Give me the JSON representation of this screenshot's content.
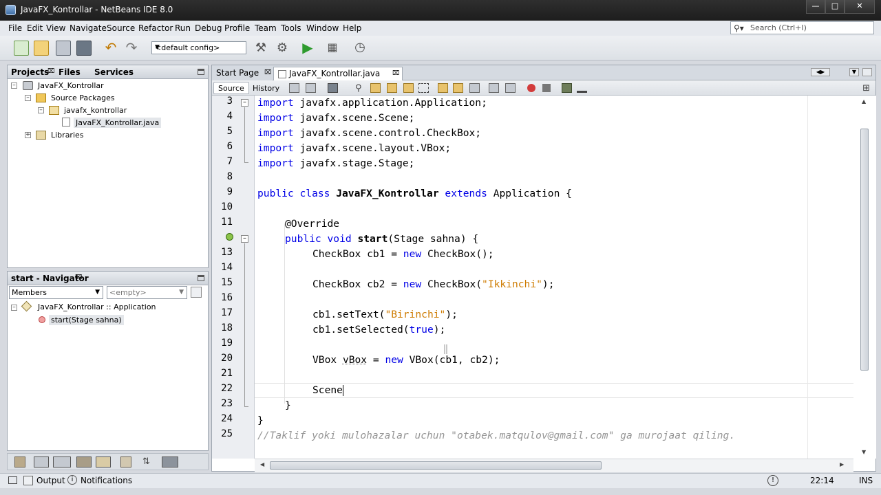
{
  "window": {
    "title": "JavaFX_Kontrollar - NetBeans IDE 8.0"
  },
  "menu": [
    "File",
    "Edit",
    "View",
    "Navigate",
    "Source",
    "Refactor",
    "Run",
    "Debug",
    "Profile",
    "Team",
    "Tools",
    "Window",
    "Help"
  ],
  "search": {
    "placeholder": "Search (Ctrl+I)"
  },
  "toolbar": {
    "config_value": "<default config>"
  },
  "projects_panel": {
    "tabs": [
      "Projects",
      "Files",
      "Services"
    ],
    "tree": [
      "JavaFX_Kontrollar",
      "Source Packages",
      "javafx_kontrollar",
      "JavaFX_Kontrollar.java",
      "Libraries"
    ]
  },
  "navigator": {
    "title": "start - Navigator",
    "members_value": "Members",
    "filter_value": "<empty>",
    "tree": [
      "JavaFX_Kontrollar :: Application",
      "start(Stage sahna)"
    ]
  },
  "editor": {
    "tabs": [
      "Start Page",
      "JavaFX_Kontrollar.java"
    ],
    "source_label": "Source",
    "history_label": "History",
    "line_numbers": [
      "3",
      "4",
      "5",
      "6",
      "7",
      "8",
      "9",
      "10",
      "11",
      "",
      "13",
      "14",
      "15",
      "16",
      "17",
      "18",
      "19",
      "20",
      "21",
      "22",
      "23",
      "24",
      "25"
    ],
    "code": {
      "l3a": "import",
      "l3b": " javafx.application.Application;",
      "l4a": "import",
      "l4b": " javafx.scene.Scene;",
      "l5a": "import",
      "l5b": " javafx.scene.control.CheckBox;",
      "l6a": "import",
      "l6b": " javafx.scene.layout.VBox;",
      "l7a": "import",
      "l7b": " javafx.stage.Stage;",
      "l9a": "public class",
      "l9b": "JavaFX_Kontrollar",
      "l9c": "extends",
      "l9d": " Application {",
      "l11": "@Override",
      "l12a": "public void",
      "l12b": "start",
      "l12c": "(Stage sahna) {",
      "l13a": "CheckBox cb1 = ",
      "l13b": "new",
      "l13c": " CheckBox();",
      "l15a": "CheckBox cb2 = ",
      "l15b": "new",
      "l15c": " CheckBox(",
      "l15d": "\"Ikkinchi\"",
      "l15e": ");",
      "l17a": "cb1.setText(",
      "l17b": "\"Birinchi\"",
      "l17c": ");",
      "l18a": "cb1.setSelected(",
      "l18b": "true",
      "l18c": ");",
      "l20a": "VBox ",
      "l20b": "vBox",
      "l20c": " = ",
      "l20d": "new",
      "l20e": " VBox(cb1, cb2);",
      "l22": "Scene",
      "l23": "}",
      "l24": "}",
      "l25": "//Taklif yoki mulohazalar uchun \"otabek.matqulov@gmail.com\" ga murojaat qiling."
    }
  },
  "status": {
    "output": "Output",
    "notifications": "Notifications",
    "position": "22:14",
    "mode": "INS"
  },
  "colors": {
    "keyword": "#0000e6",
    "string": "#ce7b00",
    "comment": "#969696"
  }
}
